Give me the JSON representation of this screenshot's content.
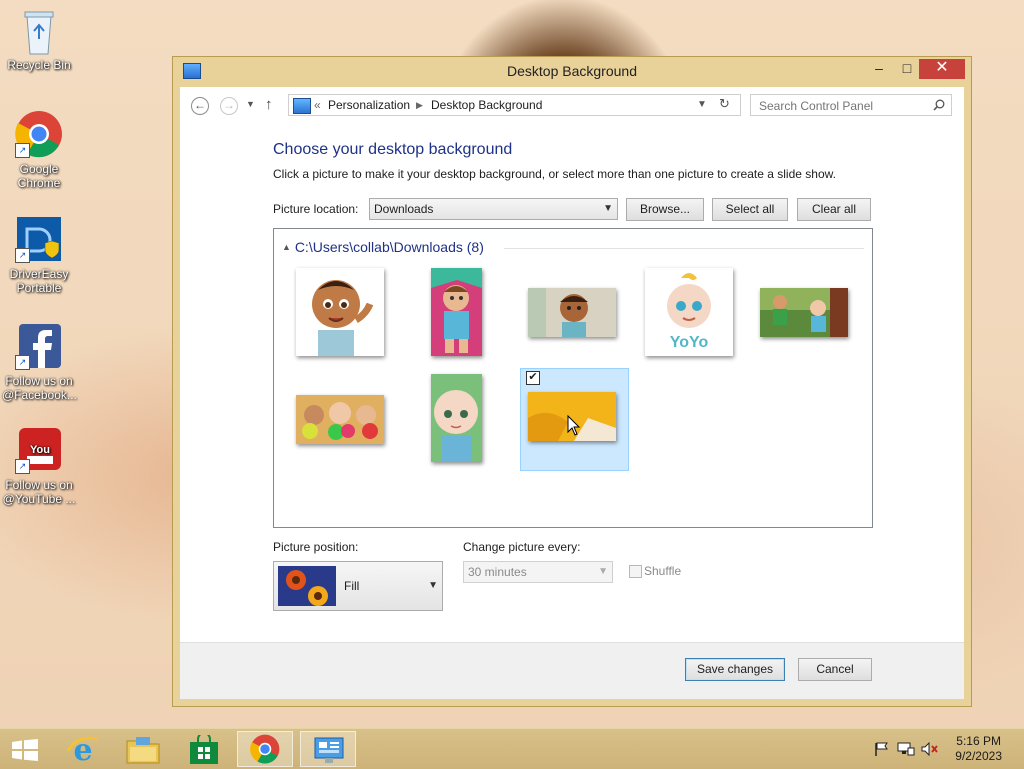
{
  "desktop": {
    "icons": [
      {
        "label": "Recycle Bin"
      },
      {
        "label": "Google Chrome"
      },
      {
        "label": "DriverEasy Portable"
      },
      {
        "label": "Follow us on @Facebook..."
      },
      {
        "label": "Follow us on @YouTube ..."
      }
    ]
  },
  "window": {
    "title": "Desktop Background",
    "nav": {
      "breadcrumb_prefix": "«",
      "crumb1": "Personalization",
      "crumb2": "Desktop Background",
      "search_placeholder": "Search Control Panel"
    },
    "heading": "Choose your desktop background",
    "description": "Click a picture to make it your desktop background, or select more than one picture to create a slide show.",
    "picture_location_label": "Picture location:",
    "picture_location_value": "Downloads",
    "browse_label": "Browse...",
    "select_all_label": "Select all",
    "clear_all_label": "Clear all",
    "group_title": "C:\\Users\\collab\\Downloads (8)",
    "picture_position_label": "Picture position:",
    "picture_position_value": "Fill",
    "change_every_label": "Change picture every:",
    "change_every_value": "30 minutes",
    "shuffle_label": "Shuffle",
    "save_label": "Save changes",
    "cancel_label": "Cancel",
    "selected_thumb_index": 8
  },
  "taskbar": {
    "time": "5:16 PM",
    "date": "9/2/2023"
  },
  "colors": {
    "accent_heading": "#1e3287",
    "selection": "#cce8ff",
    "close_button": "#c7423a"
  }
}
